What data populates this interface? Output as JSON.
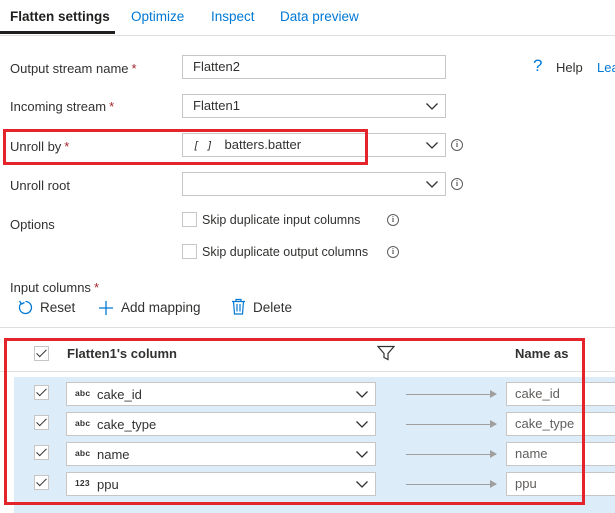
{
  "tabs": [
    {
      "label": "Flatten settings",
      "active": true
    },
    {
      "label": "Optimize"
    },
    {
      "label": "Inspect"
    },
    {
      "label": "Data preview"
    }
  ],
  "help": {
    "label": "Help",
    "learn_label": "Lea"
  },
  "form": {
    "output_stream": {
      "label": "Output stream name",
      "value": "Flatten2"
    },
    "incoming_stream": {
      "label": "Incoming stream",
      "value": "Flatten1"
    },
    "unroll_by": {
      "label": "Unroll by",
      "value": "batters.batter",
      "icon_text": "[ ]"
    },
    "unroll_root": {
      "label": "Unroll root",
      "value": ""
    },
    "options": {
      "label": "Options",
      "items": [
        {
          "label": "Skip duplicate input columns",
          "checked": false
        },
        {
          "label": "Skip duplicate output columns",
          "checked": false
        }
      ]
    },
    "required_mark": "*"
  },
  "input_columns": {
    "label": "Input columns",
    "toolbar": {
      "reset": "Reset",
      "add_mapping": "Add mapping",
      "delete": "Delete"
    }
  },
  "grid": {
    "header": {
      "column": "Flatten1's column",
      "name_as": "Name as"
    },
    "rows": [
      {
        "type": "abc",
        "column": "cake_id",
        "name_as": "cake_id",
        "checked": true
      },
      {
        "type": "abc",
        "column": "cake_type",
        "name_as": "cake_type",
        "checked": true
      },
      {
        "type": "abc",
        "column": "name",
        "name_as": "name",
        "checked": true
      },
      {
        "type": "123",
        "column": "ppu",
        "name_as": "ppu",
        "checked": true
      }
    ]
  },
  "colors": {
    "accent": "#0078d4",
    "highlight": "#e3242b",
    "selected_row": "#dcecf9"
  }
}
